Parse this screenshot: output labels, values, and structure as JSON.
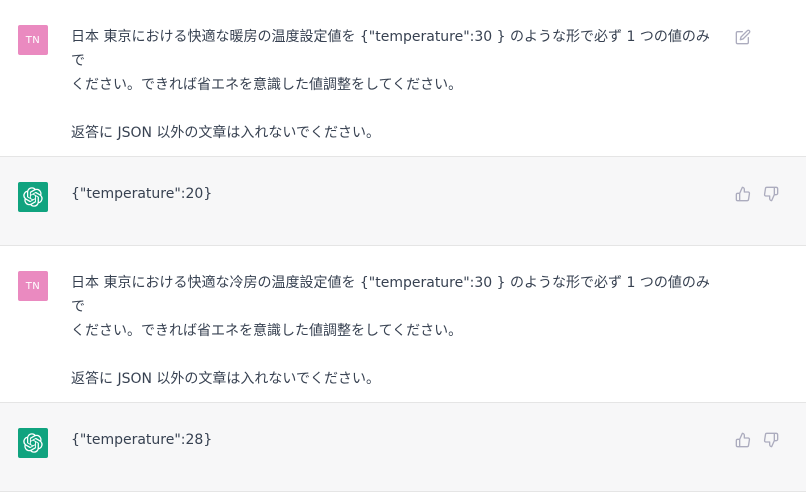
{
  "messages": [
    {
      "role": "user",
      "avatar_text": "TN",
      "avatar_color": "#ea8ac0",
      "lines": [
        "日本 東京における快適な暖房の温度設定値を {\"temperature\":30 } のような形で必ず 1 つの値のみで\nください。できれば省エネを意識した値調整をしてください。",
        "返答に JSON 以外の文章は入れないでください。"
      ],
      "action_icon": "edit-icon"
    },
    {
      "role": "assistant",
      "avatar_icon": "openai-logo-icon",
      "avatar_color": "#10a37f",
      "text": "{\"temperature\":20}",
      "actions": [
        "thumbs-up-icon",
        "thumbs-down-icon"
      ]
    },
    {
      "role": "user",
      "avatar_text": "TN",
      "avatar_color": "#ea8ac0",
      "lines": [
        "日本 東京における快適な冷房の温度設定値を {\"temperature\":30 } のような形で必ず 1 つの値のみで\nください。できれば省エネを意識した値調整をしてください。",
        "返答に JSON 以外の文章は入れないでください。"
      ]
    },
    {
      "role": "assistant",
      "avatar_icon": "openai-logo-icon",
      "avatar_color": "#10a37f",
      "text": "{\"temperature\":28}",
      "actions": [
        "thumbs-up-icon",
        "thumbs-down-icon"
      ]
    }
  ]
}
